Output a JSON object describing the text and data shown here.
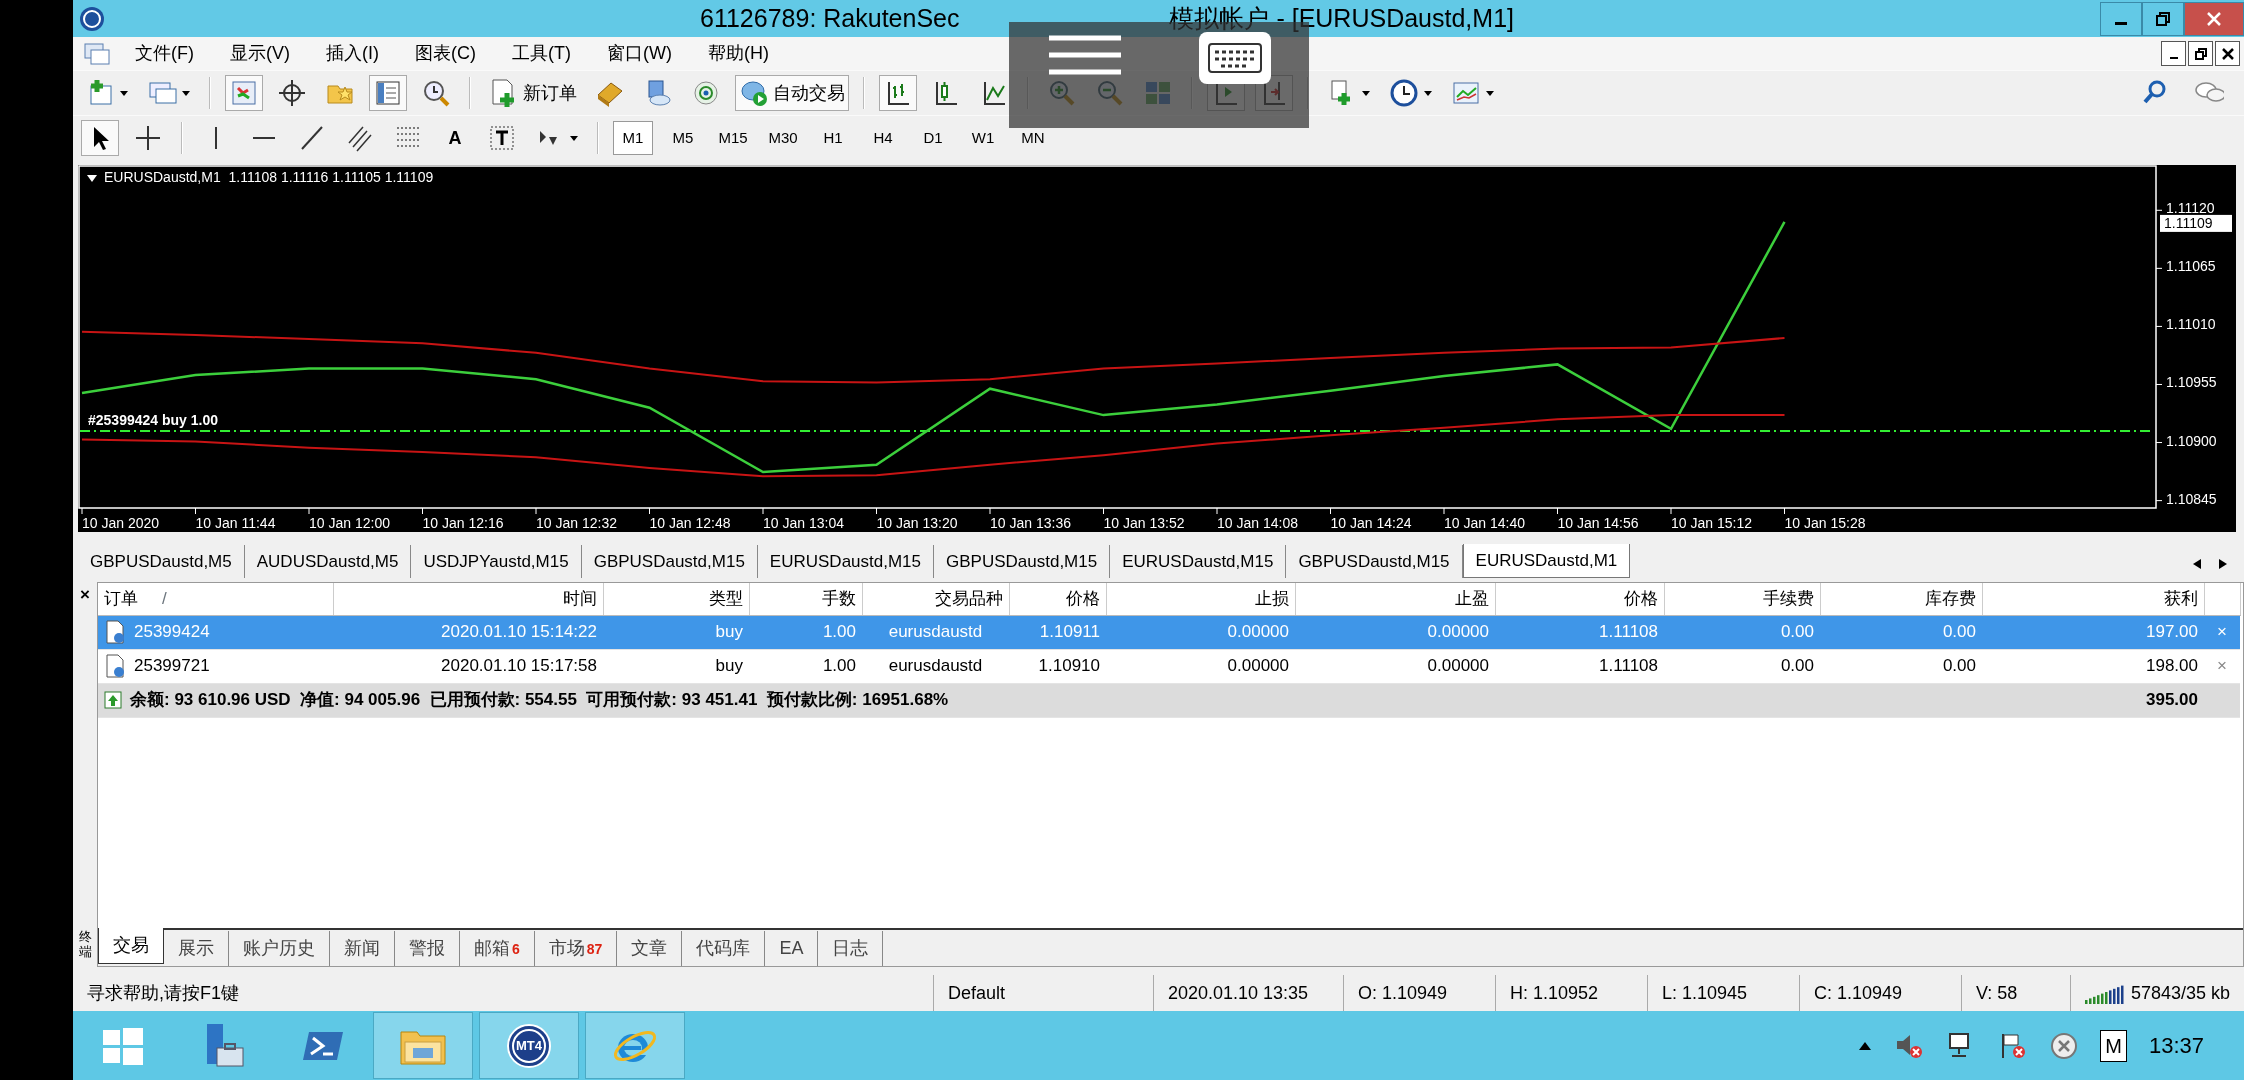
{
  "window": {
    "title_left": "61126789: RakutenSec",
    "title_right": "模拟帐户 - [EURUSDaustd,M1]"
  },
  "menu": [
    "文件(F)",
    "显示(V)",
    "插入(I)",
    "图表(C)",
    "工具(T)",
    "窗口(W)",
    "帮助(H)"
  ],
  "toolbar": {
    "new_order": "新订单",
    "auto_trading": {
      "label": "自动交易",
      "on": true
    }
  },
  "drawing_tools": {
    "text_tool": "A"
  },
  "timeframes": [
    {
      "label": "M1",
      "selected": true
    },
    {
      "label": "M5",
      "selected": false
    },
    {
      "label": "M15",
      "selected": false
    },
    {
      "label": "M30",
      "selected": false
    },
    {
      "label": "H1",
      "selected": false
    },
    {
      "label": "H4",
      "selected": false
    },
    {
      "label": "D1",
      "selected": false
    },
    {
      "label": "W1",
      "selected": false
    },
    {
      "label": "MN",
      "selected": false
    }
  ],
  "chart": {
    "header": "EURUSDaustd,M1  1.11108 1.11116 1.11105 1.11109",
    "bid_label": "1.11109",
    "chart_data": {
      "type": "line",
      "categories": [
        "10 Jan 2020",
        "10 Jan 11:44",
        "10 Jan 12:00",
        "10 Jan 12:16",
        "10 Jan 12:32",
        "10 Jan 12:48",
        "10 Jan 13:04",
        "10 Jan 13:20",
        "10 Jan 13:36",
        "10 Jan 13:52",
        "10 Jan 14:08",
        "10 Jan 14:24",
        "10 Jan 14:40",
        "10 Jan 14:56",
        "10 Jan 15:12",
        "10 Jan 15:28"
      ],
      "series": [
        {
          "color": "#3ccf3c",
          "values": [
            1.10947,
            1.10964,
            1.1097,
            1.1097,
            1.1096,
            1.10933,
            1.10872,
            1.10879,
            1.10951,
            1.10926,
            1.10936,
            1.10949,
            1.10963,
            1.10974,
            1.10913,
            1.11109
          ]
        },
        {
          "color": "#c81414",
          "values": [
            1.11005,
            1.11002,
            1.10998,
            1.10994,
            1.10985,
            1.1097,
            1.10958,
            1.10957,
            1.1096,
            1.1097,
            1.10975,
            1.1098,
            1.10985,
            1.10989,
            1.1099,
            1.10999
          ]
        },
        {
          "color": "#c81414",
          "values": [
            1.10903,
            1.10901,
            1.10895,
            1.10891,
            1.10886,
            1.10876,
            1.10868,
            1.10869,
            1.10879,
            1.10888,
            1.10899,
            1.10907,
            1.10914,
            1.10922,
            1.10926,
            1.10926
          ]
        }
      ],
      "ylim": [
        1.10838,
        1.11161
      ],
      "yticks": [
        {
          "value": 1.1112,
          "label": "1.11120"
        },
        {
          "value": 1.11065,
          "label": "1.11065"
        },
        {
          "value": 1.1101,
          "label": "1.11010"
        },
        {
          "value": 1.10955,
          "label": "1.10955"
        },
        {
          "value": 1.109,
          "label": "1.10900"
        },
        {
          "value": 1.10845,
          "label": "1.10845"
        }
      ],
      "ref_lines": [
        {
          "axis": "y",
          "value": 1.10911,
          "color": "#33ee33"
        }
      ],
      "annotations": [
        {
          "text": "#25399424 buy 1.00"
        }
      ]
    }
  },
  "chart_tabs": [
    {
      "label": "GBPUSDaustd,M5",
      "selected": false
    },
    {
      "label": "AUDUSDaustd,M5",
      "selected": false
    },
    {
      "label": "USDJPYaustd,M15",
      "selected": false
    },
    {
      "label": "GBPUSDaustd,M15",
      "selected": false
    },
    {
      "label": "EURUSDaustd,M15",
      "selected": false
    },
    {
      "label": "GBPUSDaustd,M15",
      "selected": false
    },
    {
      "label": "EURUSDaustd,M15",
      "selected": false
    },
    {
      "label": "GBPUSDaustd,M15",
      "selected": false
    },
    {
      "label": "EURUSDaustd,M1",
      "selected": true
    }
  ],
  "terminal": {
    "close": "×",
    "side_label": "终端",
    "sort_indicator": "/",
    "columns": [
      "订单",
      "时间",
      "类型",
      "手数",
      "交易品种",
      "价格",
      "止损",
      "止盈",
      "价格",
      "手续费",
      "库存费",
      "获利"
    ],
    "rows": [
      {
        "selected": true,
        "close": "×",
        "cells": [
          "25399424",
          "2020.01.10 15:14:22",
          "buy",
          "1.00",
          "eurusdaustd",
          "1.10911",
          "0.00000",
          "0.00000",
          "1.11108",
          "0.00",
          "0.00",
          "197.00"
        ]
      },
      {
        "selected": false,
        "close": "×",
        "cells": [
          "25399721",
          "2020.01.10 15:17:58",
          "buy",
          "1.00",
          "eurusdaustd",
          "1.10910",
          "0.00000",
          "0.00000",
          "1.11108",
          "0.00",
          "0.00",
          "198.00"
        ]
      }
    ],
    "summary": {
      "text": "余额: 93 610.96 USD  净值: 94 005.96  已用预付款: 554.55  可用预付款: 93 451.41  预付款比例: 16951.68%",
      "total": "395.00"
    },
    "tabs": [
      {
        "label": "交易",
        "selected": true
      },
      {
        "label": "展示",
        "selected": false
      },
      {
        "label": "账户历史",
        "selected": false
      },
      {
        "label": "新闻",
        "selected": false
      },
      {
        "label": "警报",
        "selected": false
      },
      {
        "label": "邮箱",
        "badge": "6",
        "selected": false
      },
      {
        "label": "市场",
        "badge": "87",
        "selected": false
      },
      {
        "label": "文章",
        "selected": false
      },
      {
        "label": "代码库",
        "selected": false
      },
      {
        "label": "EA",
        "selected": false
      },
      {
        "label": "日志",
        "selected": false
      }
    ]
  },
  "status_bar": {
    "help": "寻求帮助,请按F1键",
    "profile": "Default",
    "time": "2020.01.10 13:35",
    "open": "O: 1.10949",
    "high": "H: 1.10952",
    "low": "L: 1.10945",
    "close": "C: 1.10949",
    "volume": "V: 58",
    "traffic": "57843/35 kb"
  },
  "taskbar": {
    "apps": [
      {
        "kind": "start",
        "running": false
      },
      {
        "kind": "server",
        "running": false
      },
      {
        "kind": "shell",
        "running": false
      },
      {
        "kind": "folder",
        "running": true
      },
      {
        "kind": "mt4",
        "label": "MT4",
        "running": true
      },
      {
        "kind": "browser",
        "running": true
      }
    ],
    "ime": "M",
    "clock": "13:37"
  }
}
